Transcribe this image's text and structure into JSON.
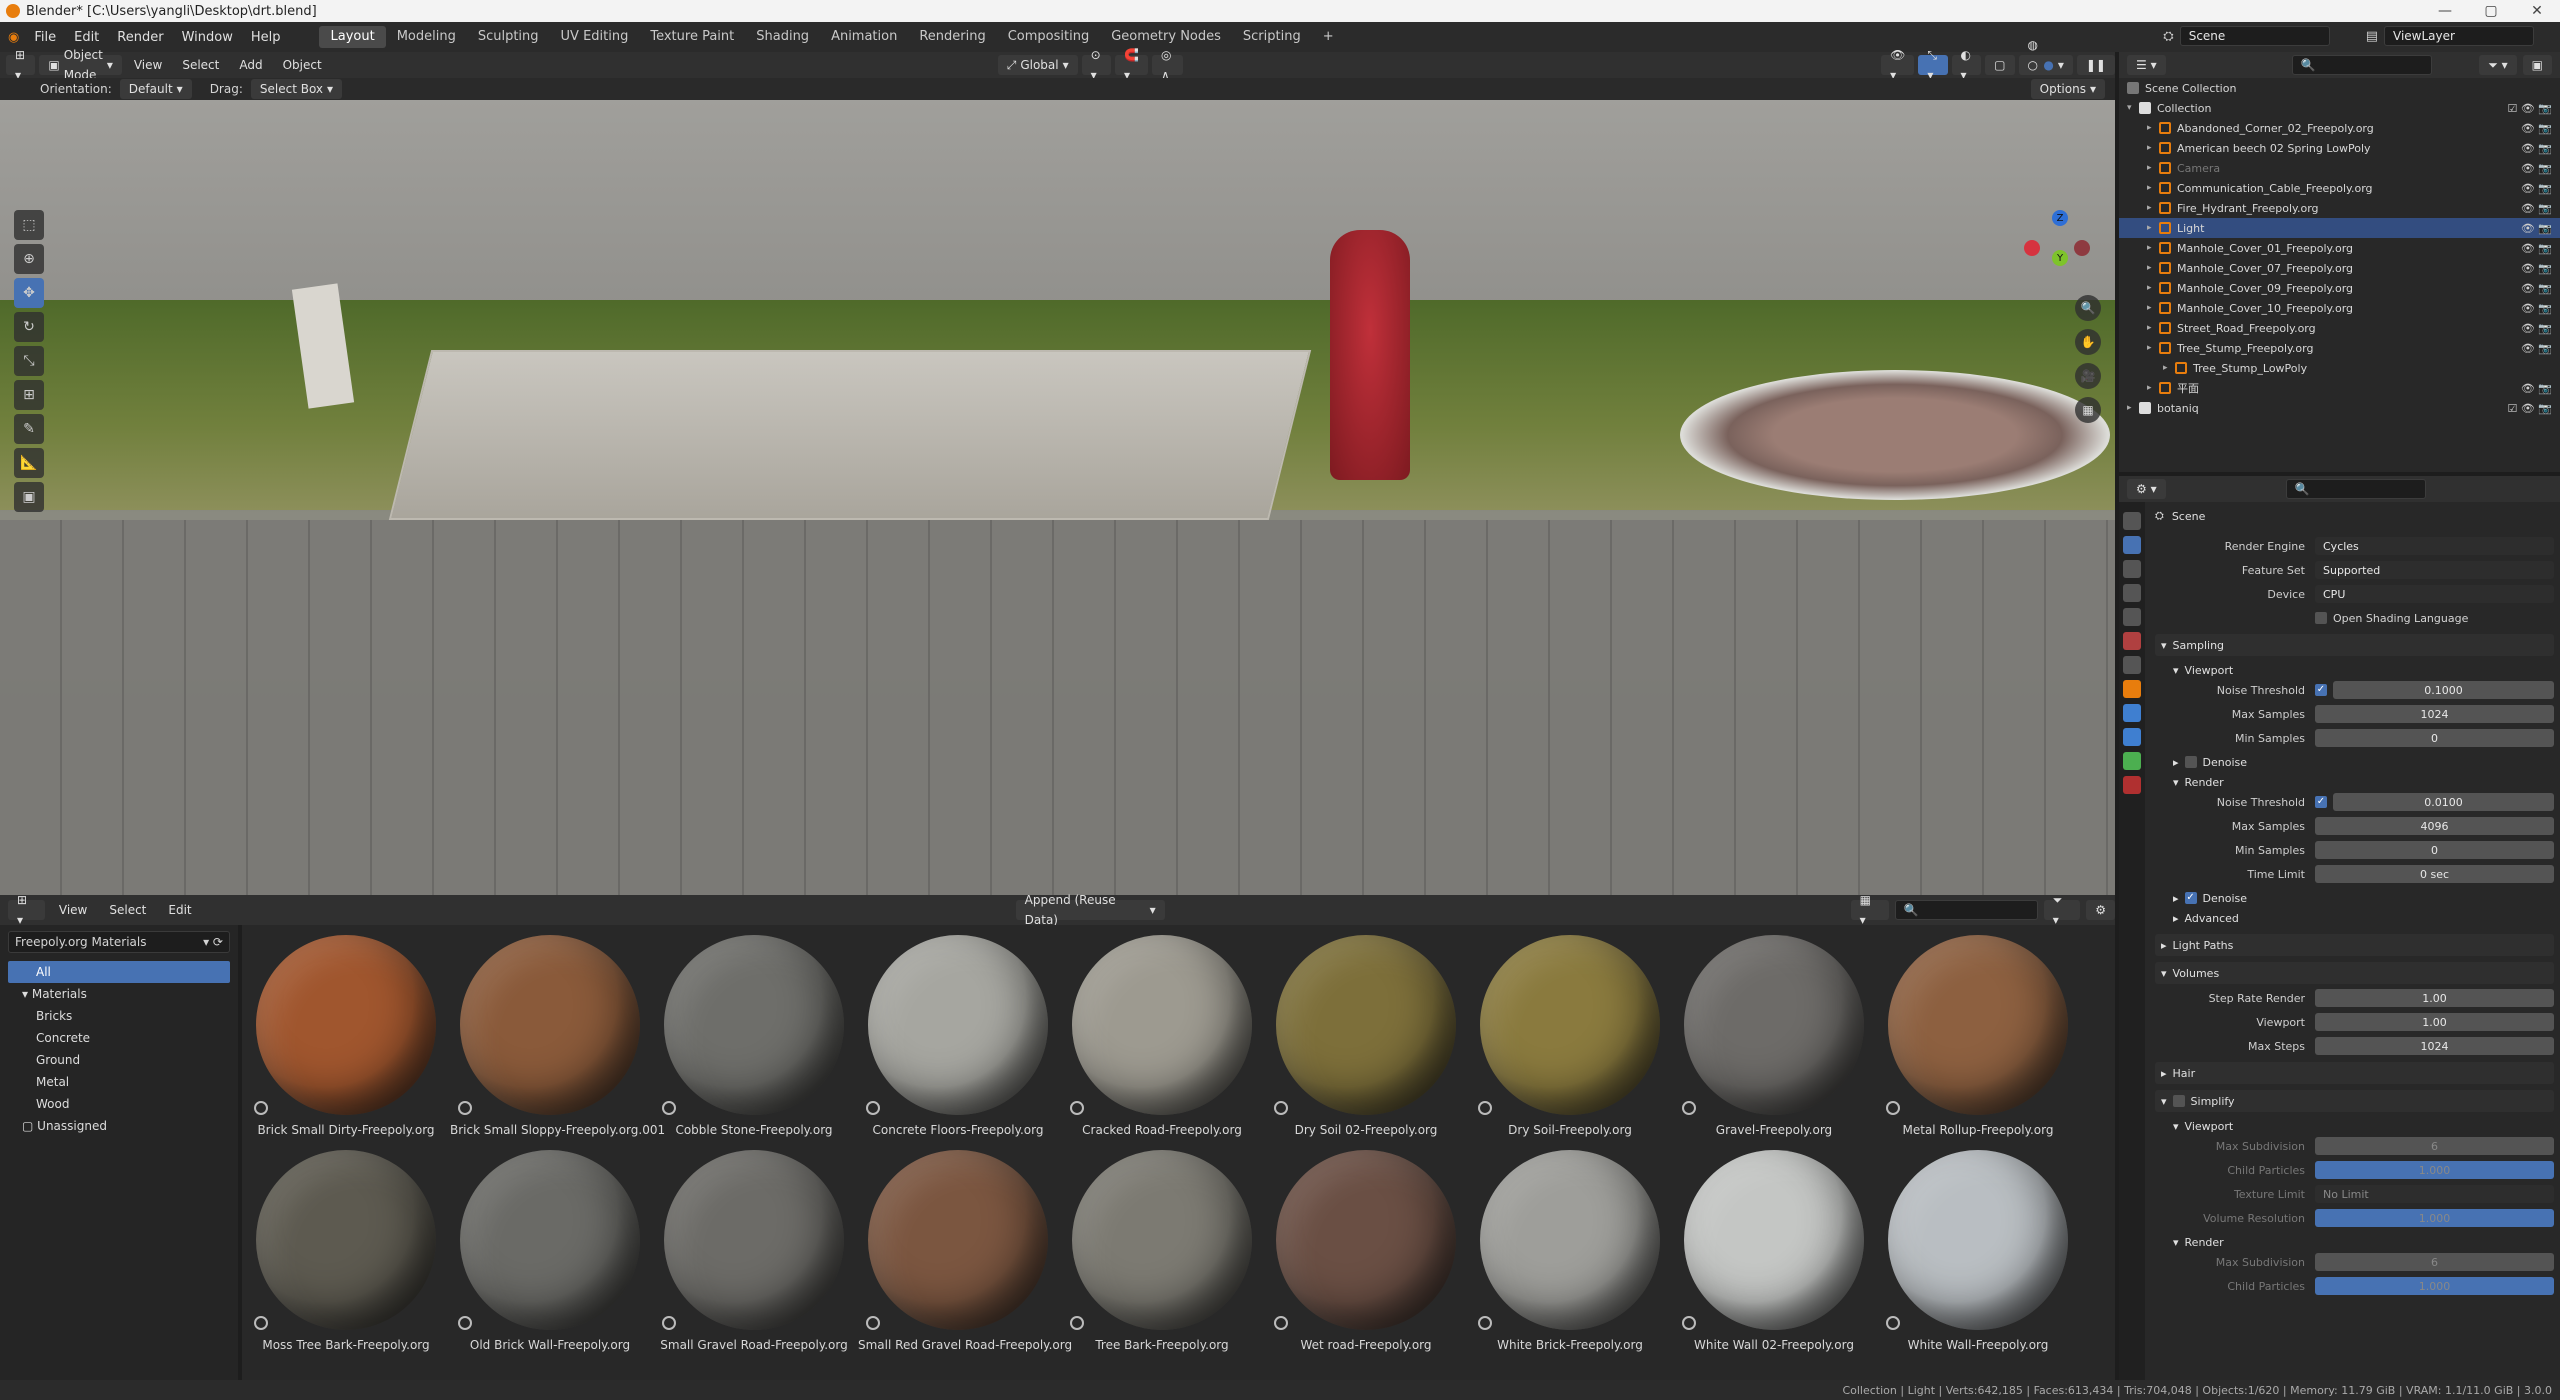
{
  "window": {
    "title": "Blender* [C:\\Users\\yangli\\Desktop\\drt.blend]"
  },
  "menu": [
    "File",
    "Edit",
    "Render",
    "Window",
    "Help"
  ],
  "workspaces": [
    "Layout",
    "Modeling",
    "Sculpting",
    "UV Editing",
    "Texture Paint",
    "Shading",
    "Animation",
    "Rendering",
    "Compositing",
    "Geometry Nodes",
    "Scripting"
  ],
  "top_right": {
    "scene": "Scene",
    "view_layer": "ViewLayer"
  },
  "viewport_header": {
    "mode": "Object Mode",
    "menus": [
      "View",
      "Select",
      "Add",
      "Object"
    ],
    "transform": "Global"
  },
  "tool_settings": {
    "orientation_label": "Orientation:",
    "orientation": "Default",
    "drag_label": "Drag:",
    "drag": "Select Box",
    "options": "Options"
  },
  "asset_browser": {
    "menus": [
      "View",
      "Select",
      "Edit"
    ],
    "import": "Append (Reuse Data)",
    "library": "Freepoly.org Materials",
    "categories": {
      "all": "All",
      "materials": "Materials",
      "items": [
        "Bricks",
        "Concrete",
        "Ground",
        "Metal",
        "Wood"
      ],
      "unassigned": "Unassigned"
    },
    "assets": [
      {
        "name": "Brick Small Dirty-Freepoly.org",
        "color": "#a0562e"
      },
      {
        "name": "Brick Small Sloppy-Freepoly.org.001",
        "color": "#8a5a3a"
      },
      {
        "name": "Cobble Stone-Freepoly.org",
        "color": "#6e6e6a"
      },
      {
        "name": "Concrete Floors-Freepoly.org",
        "color": "#a6a6a0"
      },
      {
        "name": "Cracked Road-Freepoly.org",
        "color": "#9d9a90"
      },
      {
        "name": "Dry Soil 02-Freepoly.org",
        "color": "#7d6f3a"
      },
      {
        "name": "Dry Soil-Freepoly.org",
        "color": "#8a7a3e"
      },
      {
        "name": "Gravel-Freepoly.org",
        "color": "#6d6b68"
      },
      {
        "name": "Metal Rollup-Freepoly.org",
        "color": "#8d6040"
      },
      {
        "name": "Moss Tree Bark-Freepoly.org",
        "color": "#5d5a50"
      },
      {
        "name": "Old Brick Wall-Freepoly.org",
        "color": "#6a6a66"
      },
      {
        "name": "Small Gravel Road-Freepoly.org",
        "color": "#6c6b67"
      },
      {
        "name": "Small Red Gravel Road-Freepoly.org",
        "color": "#7b5640"
      },
      {
        "name": "Tree Bark-Freepoly.org",
        "color": "#7c7a72"
      },
      {
        "name": "Wet road-Freepoly.org",
        "color": "#6a4f44"
      },
      {
        "name": "White Brick-Freepoly.org",
        "color": "#9e9e9a"
      },
      {
        "name": "White Wall 02-Freepoly.org",
        "color": "#c4c6c4"
      },
      {
        "name": "White Wall-Freepoly.org",
        "color": "#b9bec2"
      }
    ]
  },
  "outliner": {
    "root": "Scene Collection",
    "collection": "Collection",
    "items": [
      {
        "name": "Abandoned_Corner_02_Freepoly.org",
        "selected": false,
        "dim": false
      },
      {
        "name": "American beech 02 Spring LowPoly",
        "selected": false,
        "dim": false
      },
      {
        "name": "Camera",
        "selected": false,
        "dim": true
      },
      {
        "name": "Communication_Cable_Freepoly.org",
        "selected": false,
        "dim": false
      },
      {
        "name": "Fire_Hydrant_Freepoly.org",
        "selected": false,
        "dim": false
      },
      {
        "name": "Light",
        "selected": true,
        "dim": false
      },
      {
        "name": "Manhole_Cover_01_Freepoly.org",
        "selected": false,
        "dim": false
      },
      {
        "name": "Manhole_Cover_07_Freepoly.org",
        "selected": false,
        "dim": false
      },
      {
        "name": "Manhole_Cover_09_Freepoly.org",
        "selected": false,
        "dim": false
      },
      {
        "name": "Manhole_Cover_10_Freepoly.org",
        "selected": false,
        "dim": false
      },
      {
        "name": "Street_Road_Freepoly.org",
        "selected": false,
        "dim": false
      },
      {
        "name": "Tree_Stump_Freepoly.org",
        "selected": false,
        "dim": false
      }
    ],
    "child": "Tree_Stump_LowPoly",
    "extra": "平面",
    "second_collection": "botaniq"
  },
  "properties": {
    "scene": "Scene",
    "render_engine": {
      "label": "Render Engine",
      "value": "Cycles"
    },
    "feature_set": {
      "label": "Feature Set",
      "value": "Supported"
    },
    "device": {
      "label": "Device",
      "value": "CPU"
    },
    "osl": "Open Shading Language",
    "sampling": "Sampling",
    "viewport": "Viewport",
    "vp_noise": {
      "label": "Noise Threshold",
      "value": "0.1000"
    },
    "vp_max": {
      "label": "Max Samples",
      "value": "1024"
    },
    "vp_min": {
      "label": "Min Samples",
      "value": "0"
    },
    "denoise": "Denoise",
    "render": "Render",
    "r_noise": {
      "label": "Noise Threshold",
      "value": "0.0100"
    },
    "r_max": {
      "label": "Max Samples",
      "value": "4096"
    },
    "r_min": {
      "label": "Min Samples",
      "value": "0"
    },
    "time_limit": {
      "label": "Time Limit",
      "value": "0 sec"
    },
    "advanced": "Advanced",
    "light_paths": "Light Paths",
    "volumes": "Volumes",
    "step_rate": {
      "label": "Step Rate Render",
      "value": "1.00"
    },
    "vol_viewport": {
      "label": "Viewport",
      "value": "1.00"
    },
    "max_steps": {
      "label": "Max Steps",
      "value": "1024"
    },
    "hair": "Hair",
    "simplify": "Simplify",
    "max_sub": {
      "label": "Max Subdivision",
      "value": "6"
    },
    "child_particles": {
      "label": "Child Particles",
      "value": "1.000"
    },
    "texture_limit": {
      "label": "Texture Limit",
      "value": "No Limit"
    },
    "volume_res": {
      "label": "Volume Resolution",
      "value": "1.000"
    },
    "r_max_sub": {
      "label": "Max Subdivision",
      "value": "6"
    },
    "r_child": {
      "label": "Child Particles",
      "value": "1.000"
    }
  },
  "status": "Collection | Light | Verts:642,185 | Faces:613,434 | Tris:704,048 | Objects:1/620 | Memory: 11.79 GiB | VRAM: 1.1/11.0 GiB | 3.0.0"
}
